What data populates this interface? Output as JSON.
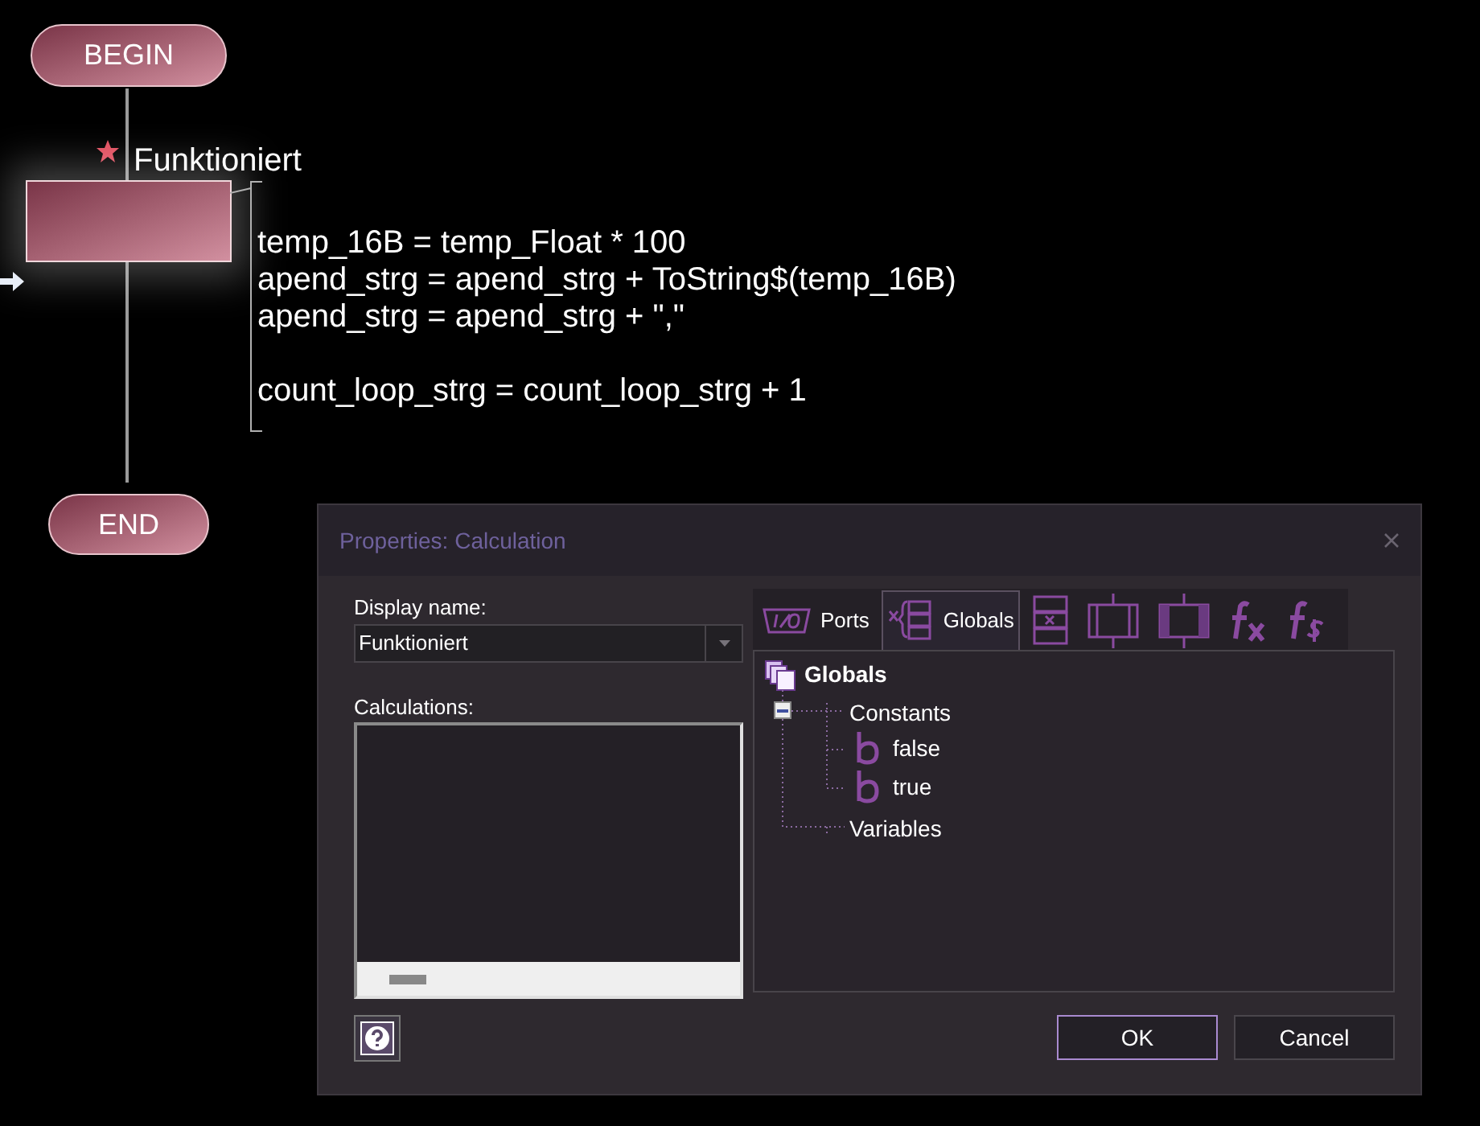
{
  "flowchart": {
    "begin": "BEGIN",
    "end": "END",
    "node": {
      "label": "Funktioniert",
      "starred": true,
      "selected": true
    },
    "code_blocks": [
      [
        "temp_16B = temp_Float * 100",
        "apend_strg = apend_strg + ToString$(temp_16B)",
        "apend_strg = apend_strg + \",\""
      ],
      [
        "count_loop_strg = count_loop_strg + 1"
      ]
    ]
  },
  "dialog": {
    "title": "Properties: Calculation",
    "display_name": {
      "label": "Display name:",
      "value": "Funktioniert"
    },
    "calculations": {
      "label": "Calculations:"
    },
    "tabs": [
      {
        "kind": "ports",
        "label": "Ports",
        "selected": false
      },
      {
        "kind": "globals",
        "label": "Globals",
        "selected": true
      },
      {
        "kind": "array",
        "selected": false
      },
      {
        "kind": "box",
        "selected": false
      },
      {
        "kind": "hatched-box",
        "selected": false
      },
      {
        "kind": "fx",
        "selected": false
      },
      {
        "kind": "fs",
        "selected": false
      }
    ],
    "tree": {
      "label": "Globals",
      "children": [
        {
          "label": "Constants",
          "expanded": true,
          "children": [
            {
              "label": "false"
            },
            {
              "label": "true"
            }
          ]
        },
        {
          "label": "Variables"
        }
      ]
    },
    "buttons": [
      {
        "label": "OK",
        "focused": true
      },
      {
        "label": "Cancel",
        "focused": false
      }
    ]
  }
}
